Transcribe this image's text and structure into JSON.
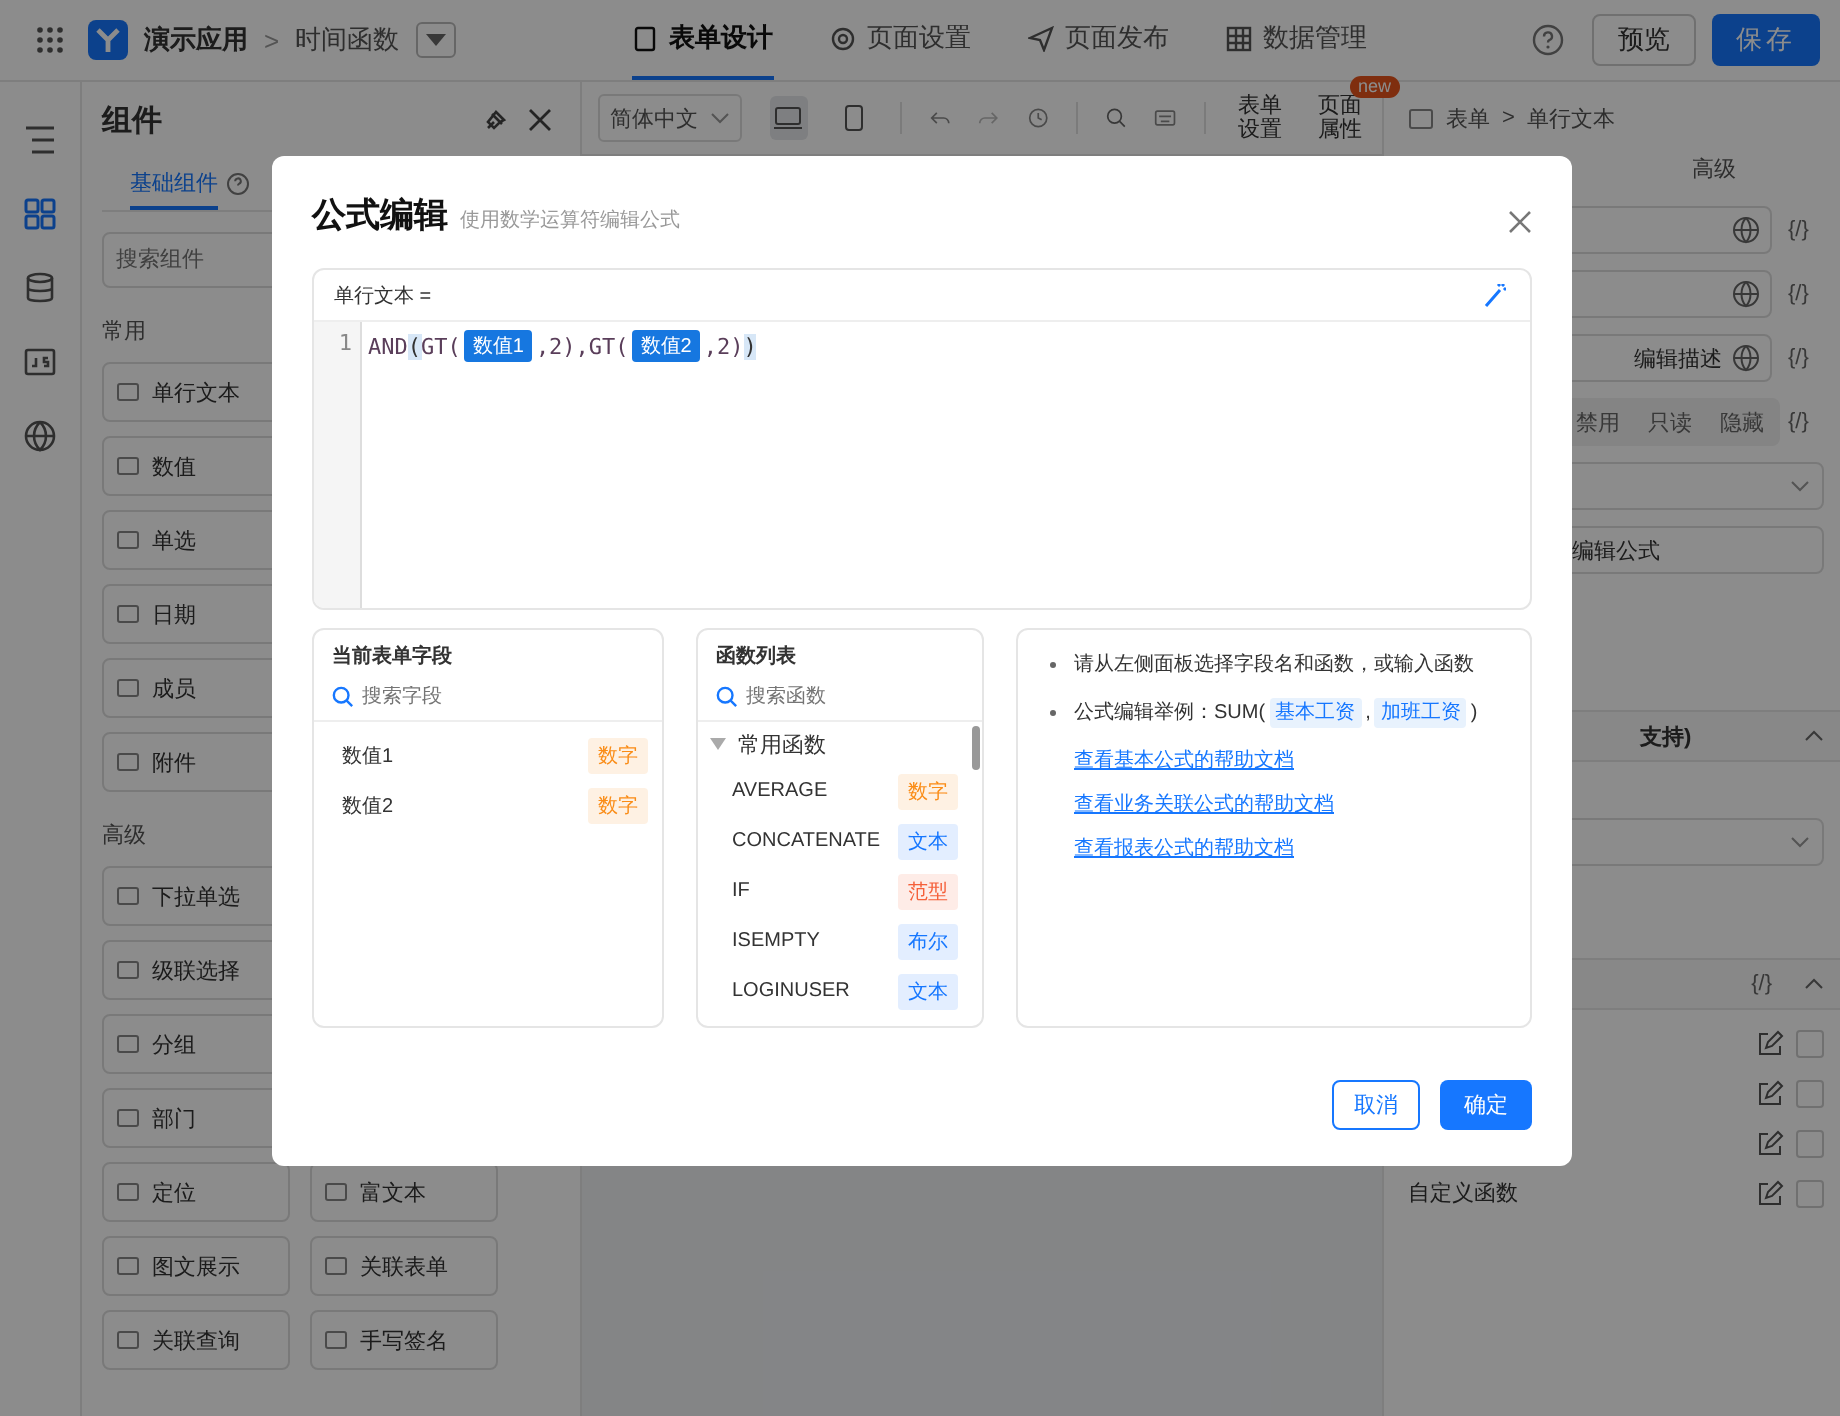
{
  "top_bar": {
    "app_name": "演示应用",
    "separator": ">",
    "page_name": "时间函数",
    "tabs": [
      {
        "label": "表单设计",
        "selected": true
      },
      {
        "label": "页面设置",
        "selected": false
      },
      {
        "label": "页面发布",
        "selected": false
      },
      {
        "label": "数据管理",
        "selected": false
      }
    ],
    "preview_button": "预览",
    "save_button": "保存"
  },
  "component_panel": {
    "title": "组件",
    "tab": {
      "label": "基础组件",
      "selected": true
    },
    "search": {
      "placeholder": "搜索组件"
    },
    "groups": [
      {
        "title": "常用",
        "rows": [
          [
            "单行文本"
          ],
          [
            "数值"
          ],
          [
            "单选"
          ],
          [
            "日期"
          ],
          [
            "成员"
          ],
          [
            "附件"
          ]
        ]
      },
      {
        "title": "高级",
        "rows": [
          [
            "下拉单选"
          ],
          [
            "级联选择"
          ],
          [
            "分组"
          ],
          [
            "部门"
          ],
          [
            "定位",
            "富文本"
          ],
          [
            "图文展示",
            "关联表单"
          ],
          [
            "关联查询",
            "手写签名"
          ]
        ]
      }
    ]
  },
  "canvas_toolbar": {
    "language": "简体中文",
    "devices": [
      {
        "kind": "desktop",
        "selected": true
      },
      {
        "kind": "mobile",
        "selected": false
      }
    ],
    "form_settings": "表单设置",
    "page_properties": "页面属性",
    "badge": "new"
  },
  "right_panel": {
    "breadcrumb": [
      "表单",
      "单行文本"
    ],
    "breadcrumb_separator": ">",
    "binding_buttons": [
      "{/}",
      "{/}",
      "{/}",
      "{/}",
      "{/}"
    ],
    "tab": "高级",
    "description_field": "编辑描述",
    "state_options": [
      "禁用",
      "只读",
      "隐藏"
    ],
    "formula_button": "编辑公式",
    "section_title": "支持)",
    "rows": [
      {
        "checked": false
      },
      {
        "checked": false
      },
      {
        "checked": false
      },
      {
        "label": "自定义函数",
        "checked": false
      }
    ]
  },
  "modal": {
    "title": "公式编辑",
    "subtitle": "使用数学运算符编辑公式",
    "editor": {
      "label": "单行文本 =",
      "line_number": "1",
      "tokens": [
        {
          "kind": "text",
          "text": "AND"
        },
        {
          "kind": "bracket",
          "text": "("
        },
        {
          "kind": "text",
          "text": "GT("
        },
        {
          "kind": "field",
          "text": "数值1"
        },
        {
          "kind": "text",
          "text": ",2),GT("
        },
        {
          "kind": "field",
          "text": "数值2"
        },
        {
          "kind": "text",
          "text": ",2)"
        },
        {
          "kind": "bracket",
          "text": ")"
        }
      ]
    },
    "fields_panel": {
      "title": "当前表单字段",
      "search": {
        "placeholder": "搜索字段"
      },
      "fields": [
        {
          "name": "数值1",
          "type": "数字",
          "color": "#fa8c16"
        },
        {
          "name": "数值2",
          "type": "数字",
          "color": "#fa8c16"
        }
      ]
    },
    "functions_panel": {
      "title": "函数列表",
      "search": {
        "placeholder": "搜索函数"
      },
      "group": {
        "label": "常用函数",
        "expanded": true
      },
      "functions": [
        {
          "name": "AVERAGE",
          "type": "数字",
          "color": "#fa8c16"
        },
        {
          "name": "CONCATENATE",
          "type": "文本",
          "color": "#1677ff"
        },
        {
          "name": "IF",
          "type": "范型",
          "color": "#f5603a"
        },
        {
          "name": "ISEMPTY",
          "type": "布尔",
          "color": "#1677ff"
        },
        {
          "name": "LOGINUSER",
          "type": "文本",
          "color": "#1677ff"
        }
      ]
    },
    "help": {
      "bullets": [
        [
          {
            "kind": "text",
            "text": "请从左侧面板选择字段名和函数，或输入函数"
          }
        ],
        [
          {
            "kind": "text",
            "text": "公式编辑举例：SUM("
          },
          {
            "kind": "field",
            "text": "基本工资"
          },
          {
            "kind": "text",
            "text": ","
          },
          {
            "kind": "field",
            "text": "加班工资"
          },
          {
            "kind": "text",
            "text": ")"
          }
        ]
      ],
      "links": [
        "查看基本公式的帮助文档",
        "查看业务关联公式的帮助文档",
        "查看报表公式的帮助文档"
      ]
    },
    "buttons": {
      "cancel": "取消",
      "confirm": "确定"
    }
  }
}
